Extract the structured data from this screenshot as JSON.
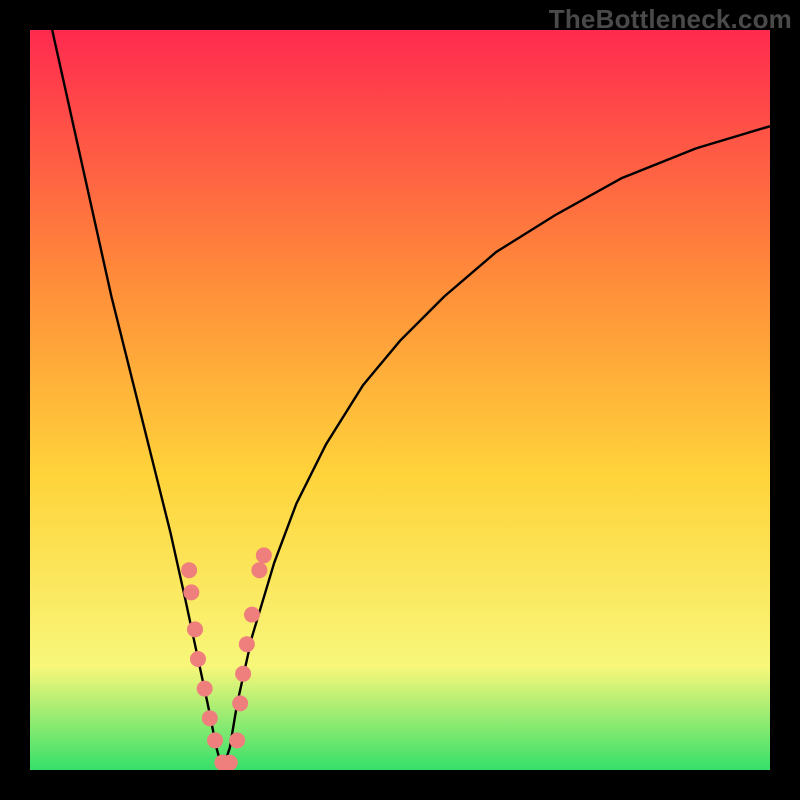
{
  "watermark": "TheBottleneck.com",
  "chart_data": {
    "type": "line",
    "title": "",
    "xlabel": "",
    "ylabel": "",
    "xlim": [
      0,
      100
    ],
    "ylim": [
      0,
      100
    ],
    "grid": false,
    "legend": false,
    "colors": {
      "gradient_top": "#ff2a4f",
      "gradient_mid_upper": "#ff8a3a",
      "gradient_mid": "#ffd33a",
      "gradient_lower": "#f8f77a",
      "gradient_bottom": "#35e06a",
      "curve": "#000000",
      "markers": "#ef7f7c"
    },
    "series": [
      {
        "name": "bottleneck-curve",
        "x": [
          3,
          5,
          7,
          9,
          11,
          13,
          15,
          17,
          19,
          21,
          22.5,
          24,
          25.2,
          26,
          27,
          28,
          30,
          33,
          36,
          40,
          45,
          50,
          56,
          63,
          71,
          80,
          90,
          100
        ],
        "y": [
          100,
          91,
          82,
          73,
          64,
          56,
          48,
          40,
          32,
          23,
          16,
          9,
          3,
          0,
          3,
          9,
          18,
          28,
          36,
          44,
          52,
          58,
          64,
          70,
          75,
          80,
          84,
          87
        ]
      }
    ],
    "markers": [
      {
        "x": 21.5,
        "y": 27
      },
      {
        "x": 21.8,
        "y": 24
      },
      {
        "x": 22.3,
        "y": 19
      },
      {
        "x": 22.7,
        "y": 15
      },
      {
        "x": 23.6,
        "y": 11
      },
      {
        "x": 24.3,
        "y": 7
      },
      {
        "x": 25.0,
        "y": 4
      },
      {
        "x": 26.0,
        "y": 1
      },
      {
        "x": 27.0,
        "y": 1
      },
      {
        "x": 28.0,
        "y": 4
      },
      {
        "x": 28.4,
        "y": 9
      },
      {
        "x": 28.8,
        "y": 13
      },
      {
        "x": 29.3,
        "y": 17
      },
      {
        "x": 30.0,
        "y": 21
      },
      {
        "x": 31.0,
        "y": 27
      },
      {
        "x": 31.6,
        "y": 29
      }
    ]
  }
}
